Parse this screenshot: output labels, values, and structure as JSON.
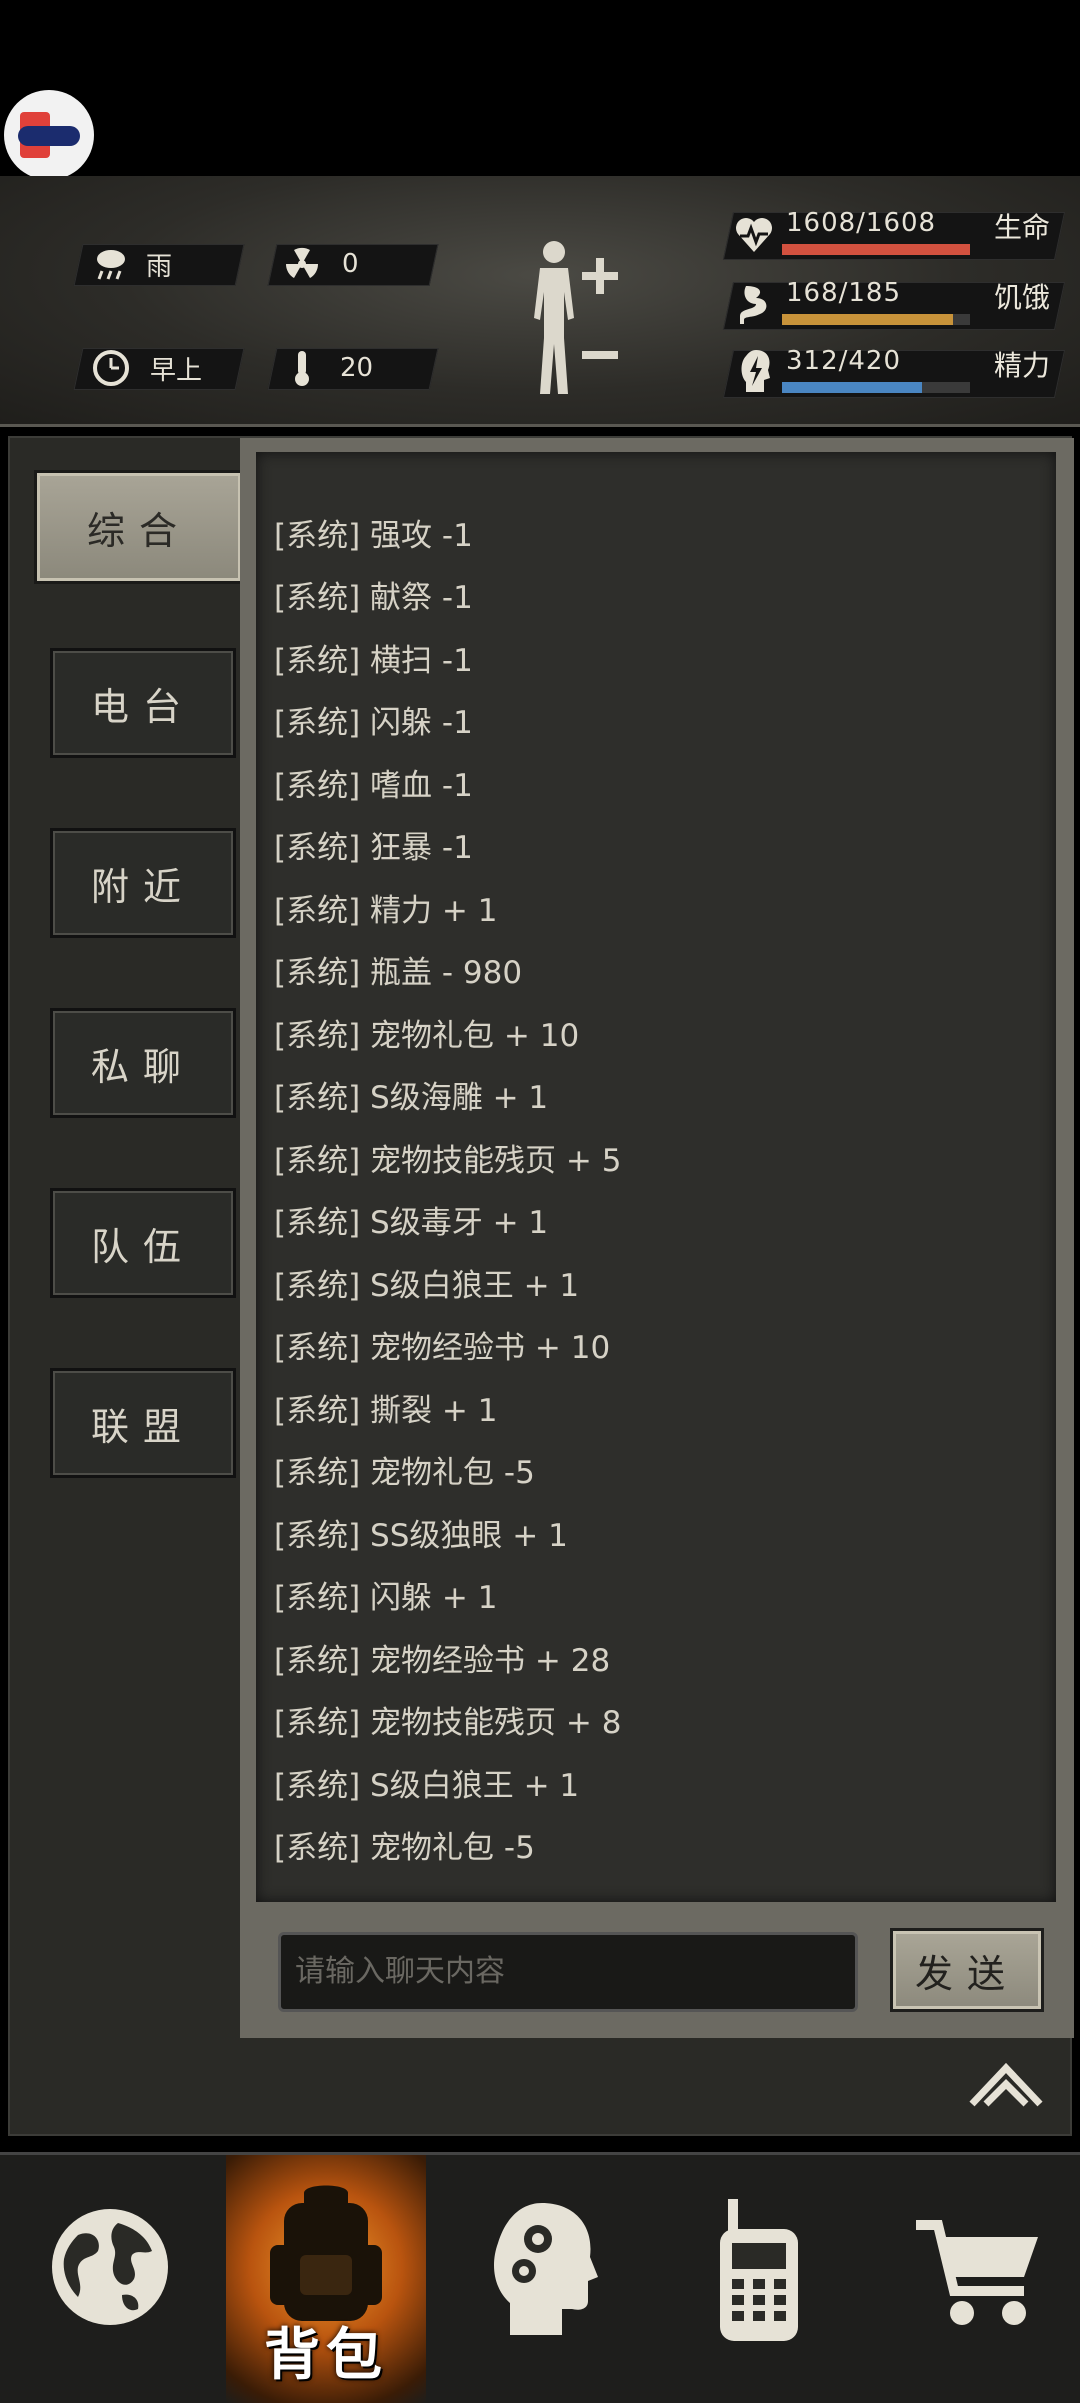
{
  "status": {
    "weather": "雨",
    "radiation": "0",
    "time_of_day": "早上",
    "temperature": "20",
    "health": {
      "value": "1608/1608",
      "label": "生命",
      "fraction": 1.0,
      "color": "#d2513f"
    },
    "hunger": {
      "value": "168/185",
      "label": "饥饿",
      "fraction": 0.908,
      "color": "#c8933a"
    },
    "energy": {
      "value": "312/420",
      "label": "精力",
      "fraction": 0.743,
      "color": "#4a86c2"
    },
    "icons": [
      "rain-cloud-icon",
      "radiation-icon",
      "clock-icon",
      "thermometer-icon",
      "human-body-icon",
      "plus-icon",
      "minus-icon",
      "heart-pulse-icon",
      "stomach-icon",
      "head-bolt-icon"
    ]
  },
  "tabs": [
    {
      "label": "综合",
      "active": true
    },
    {
      "label": "电台",
      "active": false
    },
    {
      "label": "附近",
      "active": false
    },
    {
      "label": "私聊",
      "active": false
    },
    {
      "label": "队伍",
      "active": false
    },
    {
      "label": "联盟",
      "active": false
    }
  ],
  "messages": [
    "[系统] 强攻 -1",
    "[系统] 献祭 -1",
    "[系统] 横扫 -1",
    "[系统] 闪躲 -1",
    "[系统] 嗜血 -1",
    "[系统] 狂暴 -1",
    "[系统] 精力 + 1",
    "[系统] 瓶盖 - 980",
    "[系统] 宠物礼包 + 10",
    "[系统] S级海雕 + 1",
    "[系统] 宠物技能残页 + 5",
    "[系统] S级毒牙 + 1",
    "[系统] S级白狼王 + 1",
    "[系统] 宠物经验书 + 10",
    "[系统] 撕裂 + 1",
    "[系统] 宠物礼包 -5",
    "[系统] SS级独眼 + 1",
    "[系统] 闪躲 + 1",
    "[系统] 宠物经验书 + 28",
    "[系统] 宠物技能残页 + 8",
    "[系统] S级白狼王 + 1",
    "[系统] 宠物礼包 -5"
  ],
  "chat": {
    "placeholder": "请输入聊天内容",
    "send_label": "发送"
  },
  "nav": {
    "items": [
      "world-map",
      "backpack",
      "skills",
      "radio",
      "shop"
    ],
    "active_label": "背包",
    "icons": [
      "globe-icon",
      "backpack-icon",
      "head-gears-icon",
      "walkie-talkie-icon",
      "cart-icon"
    ]
  }
}
